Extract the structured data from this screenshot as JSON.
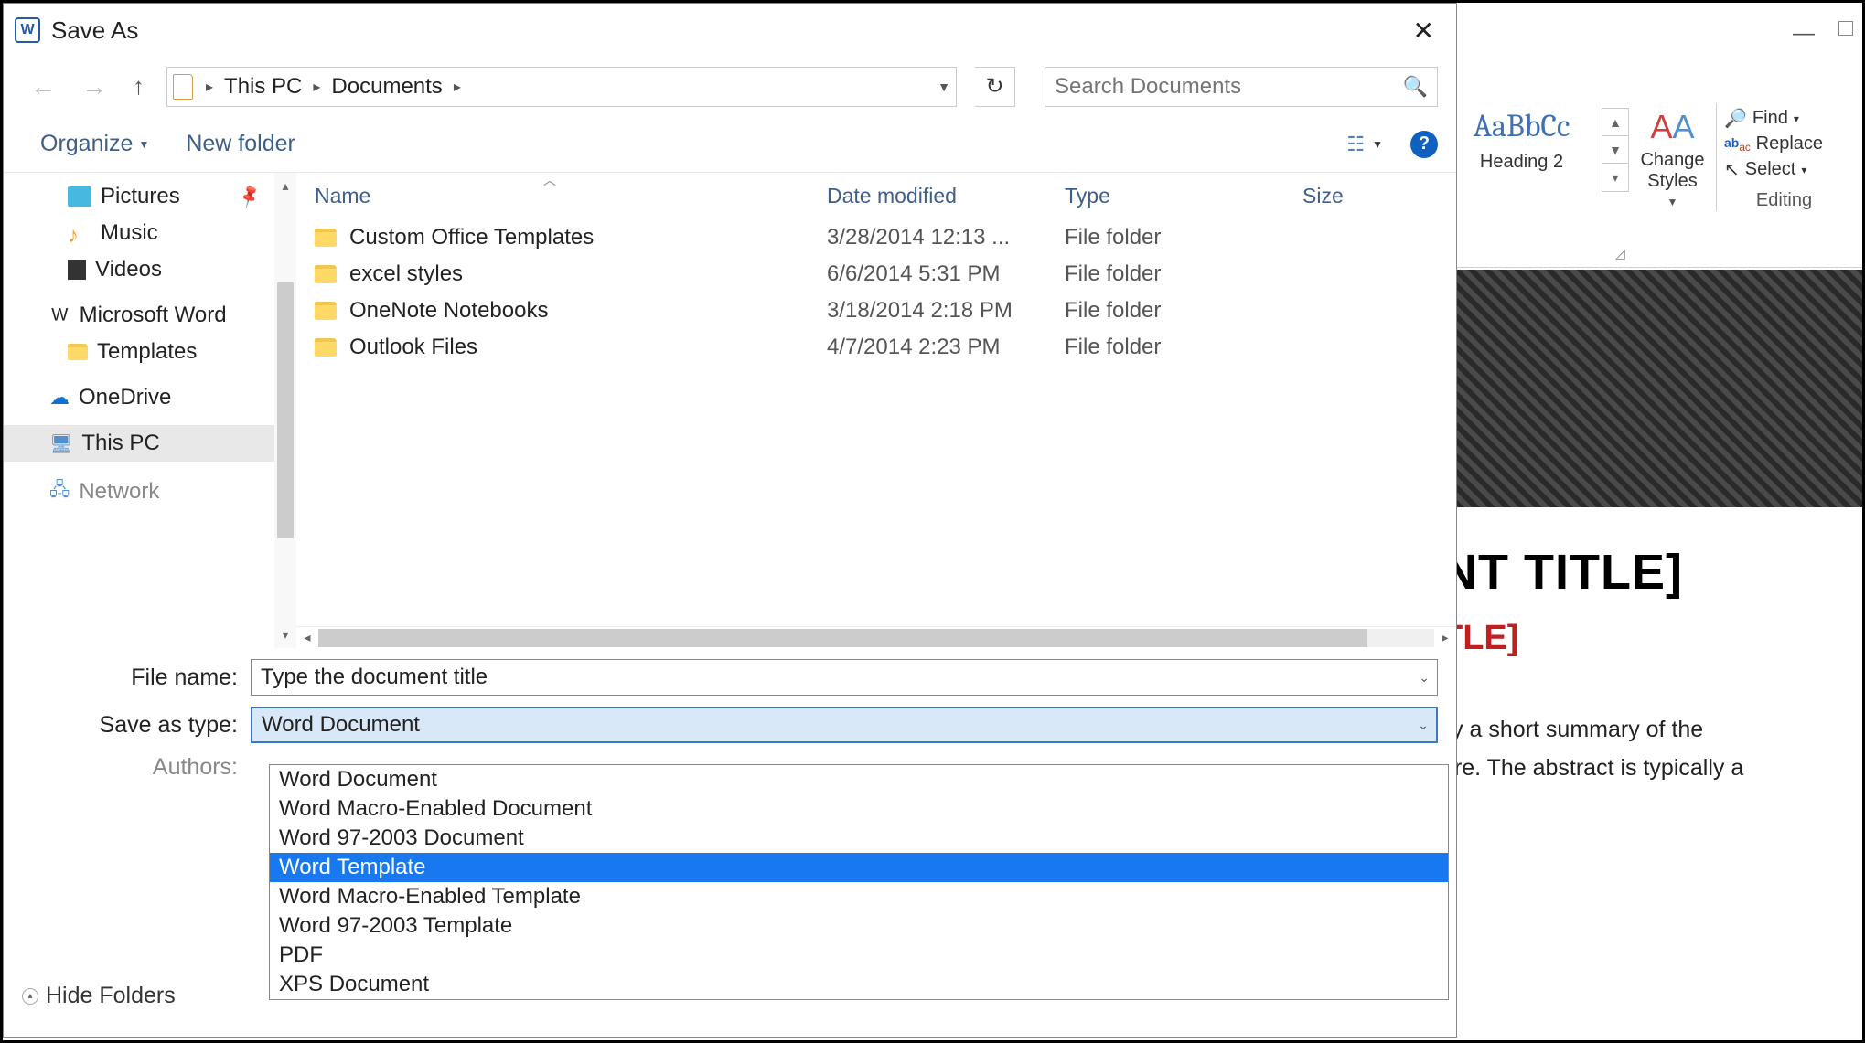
{
  "dialog": {
    "title": "Save As",
    "breadcrumb": {
      "seg1": "This PC",
      "seg2": "Documents"
    },
    "search_placeholder": "Search Documents",
    "toolbar": {
      "organize": "Organize",
      "new_folder": "New folder"
    },
    "tree": {
      "pictures": "Pictures",
      "music": "Music",
      "videos": "Videos",
      "msword": "Microsoft Word",
      "templates": "Templates",
      "onedrive": "OneDrive",
      "thispc": "This PC",
      "network": "Network"
    },
    "columns": {
      "name": "Name",
      "date": "Date modified",
      "type": "Type",
      "size": "Size"
    },
    "files": [
      {
        "name": "Custom Office Templates",
        "date": "3/28/2014 12:13 ...",
        "type": "File folder"
      },
      {
        "name": "excel styles",
        "date": "6/6/2014 5:31 PM",
        "type": "File folder"
      },
      {
        "name": "OneNote Notebooks",
        "date": "3/18/2014 2:18 PM",
        "type": "File folder"
      },
      {
        "name": "Outlook Files",
        "date": "4/7/2014 2:23 PM",
        "type": "File folder"
      }
    ],
    "form": {
      "filename_label": "File name:",
      "filename_value": "Type the document title",
      "saveas_label": "Save as type:",
      "saveas_value": "Word Document",
      "authors_label": "Authors:"
    },
    "type_options": [
      "Word Document",
      "Word Macro-Enabled Document",
      "Word 97-2003 Document",
      "Word Template",
      "Word Macro-Enabled Template",
      "Word 97-2003 Template",
      "PDF",
      "XPS Document"
    ],
    "highlighted_option_index": 3,
    "footer": {
      "hide_folders": "Hide Folders"
    }
  },
  "word_bg": {
    "style_preview": "AaBbCc",
    "style_name": "Heading 2",
    "change_styles": "Change Styles",
    "editing_group": "Editing",
    "find": "Find",
    "replace": "Replace",
    "select": "Select",
    "doc_title": "NT TITLE]",
    "doc_subtitle": "TLE]",
    "doc_body1": "lly a short summary of the",
    "doc_body2": "ere. The abstract is typically a"
  }
}
